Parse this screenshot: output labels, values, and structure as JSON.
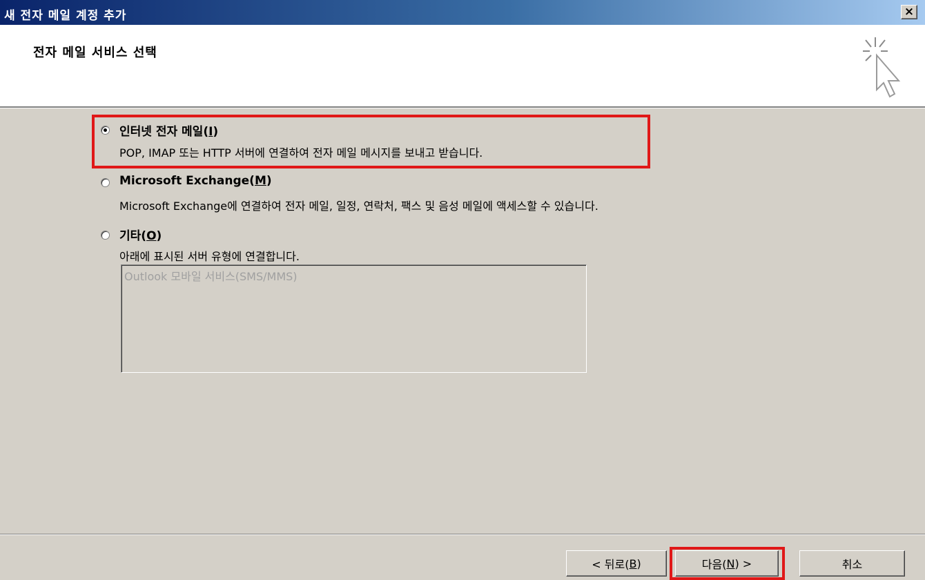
{
  "window": {
    "title": "새 전자 메일 계정 추가",
    "close_label": "×"
  },
  "header": {
    "title": "전자 메일 서비스 선택",
    "icon": "wizard-cursor-icon"
  },
  "options": [
    {
      "label_prefix": "인터넷 전자 메일(",
      "mnemonic": "I",
      "label_suffix": ")",
      "description": "POP, IMAP 또는 HTTP 서버에 연결하여 전자 메일 메시지를 보내고 받습니다.",
      "selected": true,
      "highlighted": true
    },
    {
      "label_prefix": "Microsoft Exchange(",
      "mnemonic": "M",
      "label_suffix": ")",
      "description": "Microsoft Exchange에 연결하여 전자 메일, 일정, 연락처, 팩스 및 음성 메일에 액세스할 수 있습니다.",
      "selected": false
    },
    {
      "label_prefix": "기타(",
      "mnemonic": "O",
      "label_suffix": ")",
      "description": "아래에 표시된 서버 유형에 연결합니다.",
      "selected": false
    }
  ],
  "other_services": {
    "items": [
      "Outlook 모바일 서비스(SMS/MMS)"
    ],
    "disabled": true
  },
  "buttons": {
    "back": {
      "prefix": "< 뒤로(",
      "mnemonic": "B",
      "suffix": ")"
    },
    "next": {
      "prefix": "다음(",
      "mnemonic": "N",
      "suffix": ") >",
      "highlighted": true
    },
    "cancel": {
      "label": "취소"
    }
  },
  "colors": {
    "dialog_bg": "#d4d0c8",
    "title_bar": "#0a246a",
    "highlight": "#e01818"
  }
}
